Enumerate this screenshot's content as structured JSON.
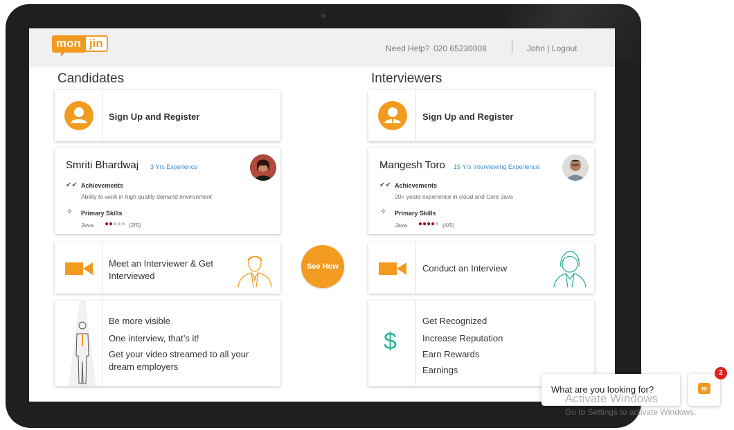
{
  "header": {
    "logo_left": "mon",
    "logo_right": "jin",
    "help_label": "Need Help?",
    "phone": "020 65230008",
    "user_links": "John | Logout"
  },
  "candidates": {
    "title": "Candidates",
    "signup": "Sign Up and Register",
    "profile": {
      "name": "Smriti Bhardwaj",
      "experience": "3 Yrs Experience",
      "achievements_label": "Achievements",
      "achievements_text": "Ability to work in high quality demand environment",
      "skills_label": "Primary Skills",
      "skill_name": "Java",
      "skill_rating": "(2/5)",
      "skill_level": 2
    },
    "meet_line1": "Meet an Interviewer & Get",
    "meet_line2": "Interviewed",
    "benefits": [
      "Be more visible",
      "One interview, that’s it!",
      "Get your video streamed to all your",
      "dream employers"
    ]
  },
  "interviewers": {
    "title": "Interviewers",
    "signup": "Sign Up and Register",
    "profile": {
      "name": "Mangesh Toro",
      "experience": "15 Yrs Interviewing Experience",
      "achievements_label": "Achievements",
      "achievements_text": "20+ years experience in cloud and Core Java",
      "skills_label": "Primary Skills",
      "skill_name": "Java",
      "skill_rating": "(4/5)",
      "skill_level": 4
    },
    "conduct": "Conduct an Interview",
    "dollar": "$",
    "benefits": [
      "Get Recognized",
      "Increase Reputation",
      "Earn Rewards",
      "Earnings"
    ]
  },
  "see_how": "See How",
  "chat": {
    "prompt": "What are you looking for?",
    "icon_letter": "m",
    "badge_count": "2"
  },
  "watermark": {
    "line1": "Activate Windows",
    "line2": "Go to Settings to activate Windows."
  },
  "colors": {
    "brand_orange": "#f39a21",
    "teal": "#2bb39a",
    "link_blue": "#3c8fd1",
    "dot_red": "#a01d2a"
  }
}
